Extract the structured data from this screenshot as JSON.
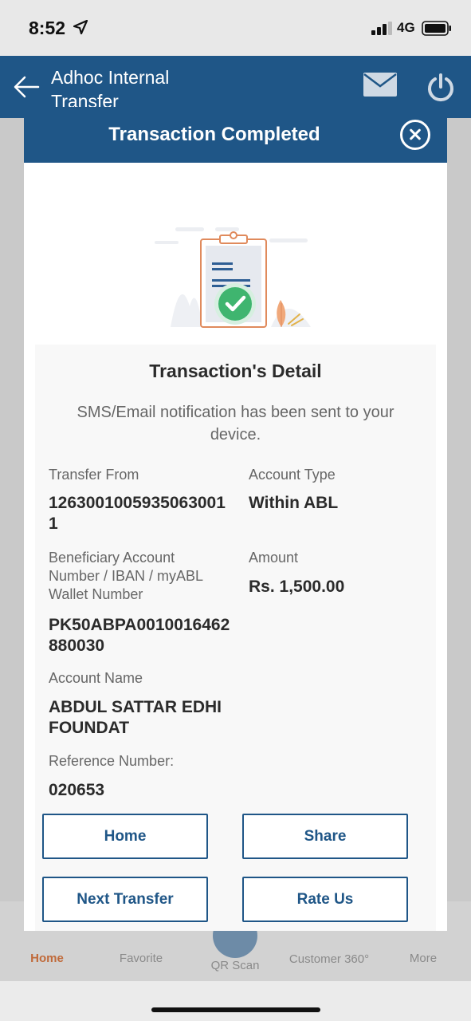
{
  "status_bar": {
    "time": "8:52",
    "network": "4G"
  },
  "app_header": {
    "title": "Adhoc Internal Transfer"
  },
  "tabs": [
    {
      "label": "Home"
    },
    {
      "label": "Favorite"
    },
    {
      "label": "QR Scan"
    },
    {
      "label": "Customer 360°"
    },
    {
      "label": "More"
    }
  ],
  "modal": {
    "title": "Transaction Completed",
    "detail_title": "Transaction's Detail",
    "note": "SMS/Email notification has been sent to your device.",
    "fields": {
      "transfer_from_label": "Transfer From",
      "transfer_from_value": "12630010059350630011",
      "account_type_label": "Account Type",
      "account_type_value": "Within ABL",
      "beneficiary_label": "Beneficiary Account Number / IBAN / myABL Wallet Number",
      "beneficiary_value": "PK50ABPA0010016462880030",
      "amount_label": "Amount",
      "amount_value": "Rs. 1,500.00",
      "account_name_label": "Account Name",
      "account_name_value": "ABDUL SATTAR EDHI FOUNDAT",
      "reference_label": "Reference Number:",
      "reference_value": "020653"
    },
    "buttons": {
      "home": "Home",
      "share": "Share",
      "next_transfer": "Next Transfer",
      "rate_us": "Rate Us"
    }
  },
  "colors": {
    "brand": "#1f5687",
    "success": "#3fb56f",
    "accent": "#c06a3a"
  }
}
